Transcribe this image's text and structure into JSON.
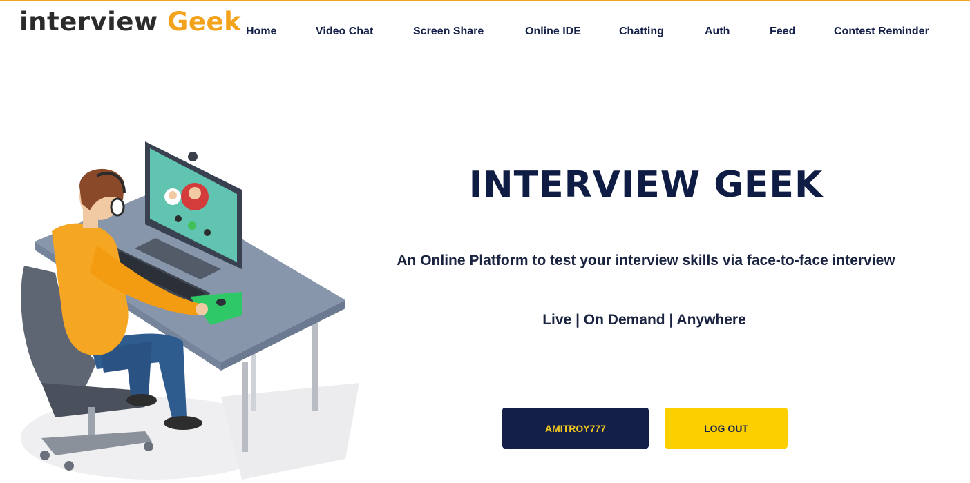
{
  "brand": {
    "part1": "interview",
    "part2": "Geek",
    "color_dark": "#2b2b2b",
    "color_accent": "#f3a21b"
  },
  "nav": {
    "items": [
      {
        "label": "Home"
      },
      {
        "label": "Video Chat"
      },
      {
        "label": "Screen Share"
      },
      {
        "label": "Online IDE"
      },
      {
        "label": "Chatting"
      },
      {
        "label": "Auth"
      },
      {
        "label": "Feed"
      },
      {
        "label": "Contest Reminder"
      }
    ]
  },
  "hero": {
    "title": "INTERVIEW GEEK",
    "tagline": "An Online Platform to test your interview skills via face-to-face interview",
    "subline": "Live | On Demand | Anywhere",
    "title_color": "#0f1c44"
  },
  "buttons": {
    "user_label": "AMITROY777",
    "logout_label": "LOG OUT",
    "user_bg": "#141f49",
    "logout_bg": "#fcd000"
  },
  "illustration": {
    "name": "person-at-computer-video-call-illustration"
  }
}
